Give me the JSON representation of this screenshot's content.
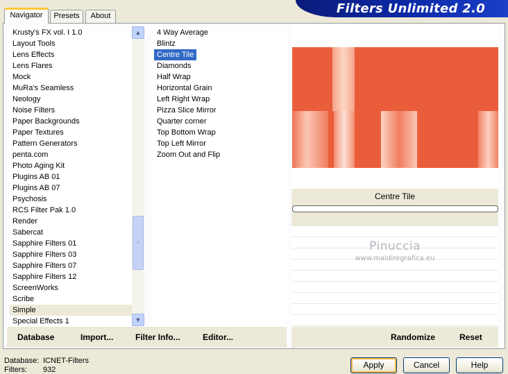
{
  "tabs": [
    {
      "label": "Navigator"
    },
    {
      "label": "Presets"
    },
    {
      "label": "About"
    }
  ],
  "app_title": "Filters Unlimited 2.0",
  "categories": [
    "Krusty's FX vol. I 1.0",
    "Layout Tools",
    "Lens Effects",
    "Lens Flares",
    "Mock",
    "MuRa's Seamless",
    "Neology",
    "Noise Filters",
    "Paper Backgrounds",
    "Paper Textures",
    "Pattern Generators",
    "penta.com",
    "Photo Aging Kit",
    "Plugins AB 01",
    "Plugins AB 07",
    "Psychosis",
    "RCS Filter Pak 1.0",
    "Render",
    "Sabercat",
    "Sapphire Filters 01",
    "Sapphire Filters 03",
    "Sapphire Filters 07",
    "Sapphire Filters 12",
    "ScreenWorks",
    "Scribe",
    "Simple",
    "Special Effects 1"
  ],
  "selected_category_index": 25,
  "filters": [
    "4 Way Average",
    "Blintz",
    "Centre Tile",
    "Diamonds",
    "Half Wrap",
    "Horizontal Grain",
    "Left Right Wrap",
    "Pizza Slice Mirror",
    "Quarter corner",
    "Top Bottom Wrap",
    "Top Left Mirror",
    "Zoom Out and Flip"
  ],
  "selected_filter_index": 2,
  "preview": {
    "filter_name": "Centre Tile",
    "base_color": "#ea5d3b",
    "watermark": "Pinuccia",
    "watermark_url": "www.maidiregrafica.eu"
  },
  "toolbar": {
    "database": "Database",
    "import": "Import...",
    "filter_info": "Filter Info...",
    "editor": "Editor...",
    "randomize": "Randomize",
    "reset": "Reset"
  },
  "status": {
    "database_label": "Database:",
    "database_value": "ICNET-Filters",
    "filters_label": "Filters:",
    "filters_value": "932"
  },
  "buttons": {
    "apply": "Apply",
    "cancel": "Cancel",
    "help": "Help"
  }
}
